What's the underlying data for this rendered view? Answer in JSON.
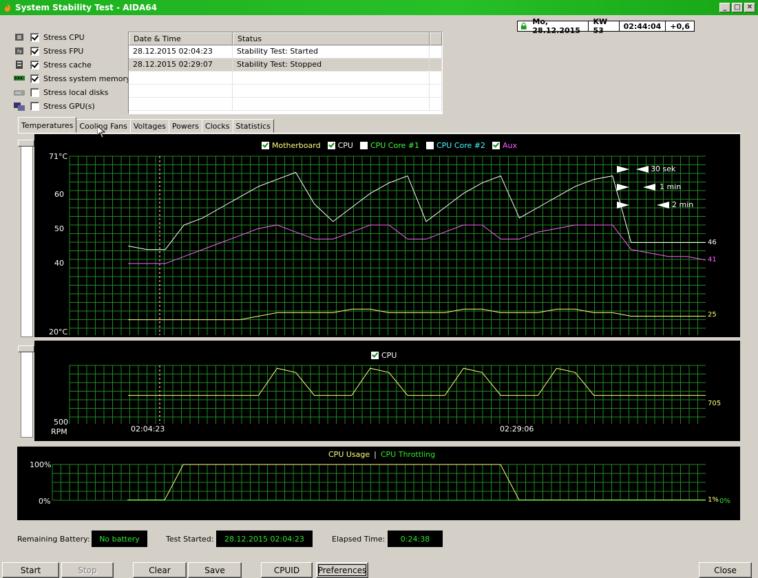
{
  "window": {
    "title": "System Stability Test - AIDA64"
  },
  "clock": {
    "date": "Mo, 28.12.2015",
    "week": "KW 53",
    "time": "02:44:04",
    "offset": "+0,6"
  },
  "stress": [
    {
      "label": "Stress CPU",
      "checked": true,
      "icon": "cpu-chip-icon"
    },
    {
      "label": "Stress FPU",
      "checked": true,
      "icon": "fpu-chip-icon"
    },
    {
      "label": "Stress cache",
      "checked": true,
      "icon": "cache-icon"
    },
    {
      "label": "Stress system memory",
      "checked": true,
      "icon": "memory-module-icon"
    },
    {
      "label": "Stress local disks",
      "checked": false,
      "icon": "disk-drive-icon"
    },
    {
      "label": "Stress GPU(s)",
      "checked": false,
      "icon": "gpu-icon"
    }
  ],
  "log": {
    "headers": [
      "Date & Time",
      "Status"
    ],
    "rows": [
      {
        "time": "28.12.2015 02:04:23",
        "status": "Stability Test: Started"
      },
      {
        "time": "28.12.2015 02:29:07",
        "status": "Stability Test: Stopped"
      }
    ]
  },
  "tabs": [
    "Temperatures",
    "Cooling Fans",
    "Voltages",
    "Powers",
    "Clocks",
    "Statistics"
  ],
  "temp_graph": {
    "legend": [
      {
        "label": "Motherboard",
        "checked": true,
        "color": "#ffff80"
      },
      {
        "label": "CPU",
        "checked": true,
        "color": "#ffffff"
      },
      {
        "label": "CPU Core #1",
        "checked": false,
        "color": "#40ff40"
      },
      {
        "label": "CPU Core #2",
        "checked": false,
        "color": "#40ffff"
      },
      {
        "label": "Aux",
        "checked": true,
        "color": "#ff60ff"
      }
    ],
    "y_top": "71°C",
    "y_bottom": "20°C",
    "ticks": [
      "60",
      "50",
      "40"
    ],
    "values": {
      "cpu": "46",
      "aux": "41",
      "motherboard": "25"
    },
    "scale_options": [
      "30 sek",
      "1 min",
      "2 min"
    ]
  },
  "fan_graph": {
    "legend": [
      {
        "label": "CPU",
        "checked": true
      }
    ],
    "y_bottom": "500",
    "unit": "RPM",
    "value": "705",
    "time_start": "02:04:23",
    "time_end": "02:29:06"
  },
  "usage_graph": {
    "title_usage": "CPU Usage",
    "separator": "|",
    "title_throttle": "CPU Throttling",
    "y_top": "100%",
    "y_bottom": "0%",
    "value_usage": "1%",
    "value_throttle": "0%"
  },
  "status": {
    "battery_label": "Remaining Battery:",
    "battery_value": "No battery",
    "started_label": "Test Started:",
    "started_value": "28.12.2015 02:04:23",
    "elapsed_label": "Elapsed Time:",
    "elapsed_value": "0:24:38"
  },
  "buttons": {
    "start": "Start",
    "stop": "Stop",
    "clear": "Clear",
    "save": "Save",
    "cpuid": "CPUID",
    "preferences": "Preferences",
    "close": "Close"
  },
  "chart_data": [
    {
      "type": "line",
      "x_range": [
        "02:04:23",
        "02:29:06"
      ],
      "ylim": [
        20,
        71
      ],
      "ylabel": "°C",
      "series": [
        {
          "name": "CPU",
          "color": "#ffffff",
          "values": [
            45,
            44,
            44,
            51,
            53,
            56,
            59,
            62,
            64,
            66,
            57,
            52,
            56,
            60,
            63,
            65,
            52,
            56,
            60,
            63,
            65,
            53,
            56,
            59,
            62,
            64,
            65,
            46,
            46,
            46,
            46,
            46
          ]
        },
        {
          "name": "Aux",
          "color": "#ff60ff",
          "values": [
            40,
            40,
            40,
            42,
            44,
            46,
            48,
            50,
            51,
            49,
            47,
            47,
            49,
            51,
            51,
            47,
            47,
            49,
            51,
            51,
            47,
            47,
            49,
            50,
            51,
            51,
            51,
            44,
            43,
            42,
            42,
            41
          ]
        },
        {
          "name": "Motherboard",
          "color": "#ffff80",
          "values": [
            24,
            24,
            24,
            24,
            24,
            24,
            24,
            25,
            26,
            26,
            26,
            26,
            27,
            27,
            26,
            26,
            26,
            26,
            27,
            27,
            26,
            26,
            26,
            27,
            27,
            26,
            26,
            25,
            25,
            25,
            25,
            25
          ]
        }
      ]
    },
    {
      "type": "line",
      "ylabel": "RPM",
      "series": [
        {
          "name": "CPU",
          "color": "#ffff80",
          "values": [
            705,
            705,
            705,
            705,
            705,
            705,
            705,
            705,
            900,
            870,
            705,
            705,
            705,
            900,
            870,
            705,
            705,
            705,
            900,
            870,
            705,
            705,
            705,
            900,
            870,
            705,
            705,
            705,
            705,
            705,
            705,
            705
          ]
        }
      ]
    },
    {
      "type": "line",
      "ylim": [
        0,
        100
      ],
      "series": [
        {
          "name": "CPU Usage",
          "color": "#ffff80",
          "values": [
            1,
            1,
            1,
            100,
            100,
            100,
            100,
            100,
            100,
            100,
            100,
            100,
            100,
            100,
            100,
            100,
            100,
            100,
            100,
            100,
            100,
            1,
            1,
            1,
            1,
            1,
            1,
            1,
            1,
            1,
            1,
            1
          ]
        },
        {
          "name": "CPU Throttling",
          "color": "#2ee82e",
          "values": [
            0,
            0,
            0,
            0,
            0,
            0,
            0,
            0,
            0,
            0,
            0,
            0,
            0,
            0,
            0,
            0,
            0,
            0,
            0,
            0,
            0,
            0,
            0,
            0,
            0,
            0,
            0,
            0,
            0,
            0,
            0,
            0
          ]
        }
      ]
    }
  ]
}
